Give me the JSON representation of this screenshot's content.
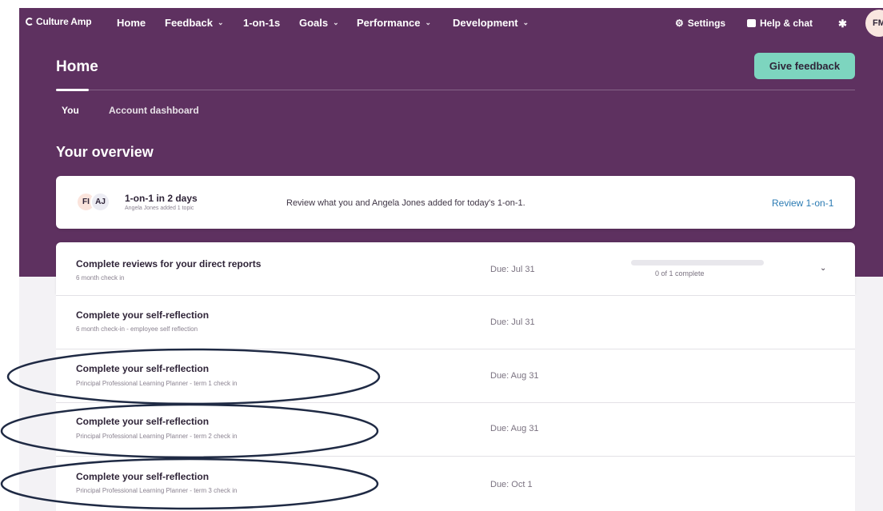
{
  "nav": {
    "logo": "Culture Amp",
    "items": [
      {
        "label": "Home",
        "has_menu": false
      },
      {
        "label": "Feedback",
        "has_menu": true
      },
      {
        "label": "1-on-1s",
        "has_menu": false
      },
      {
        "label": "Goals",
        "has_menu": true
      },
      {
        "label": "Performance",
        "has_menu": true
      },
      {
        "label": "Development",
        "has_menu": true
      }
    ],
    "settings": "Settings",
    "help": "Help & chat",
    "avatar": "FM",
    "chevron_glyph": "⌄"
  },
  "header": {
    "title": "Home",
    "give_feedback": "Give feedback",
    "tabs": [
      {
        "label": "You",
        "active": true
      },
      {
        "label": "Account dashboard",
        "active": false
      }
    ]
  },
  "overview": {
    "title": "Your overview",
    "one_on_one": {
      "avatars": [
        "FI",
        "AJ"
      ],
      "title": "1-on-1 in 2 days",
      "subtitle": "Angela Jones added 1 topic",
      "description": "Review what you and Angela Jones added for today's 1-on-1.",
      "link": "Review 1-on-1"
    }
  },
  "tasks": [
    {
      "title": "Complete reviews for your direct reports",
      "subtitle": "6 month check in",
      "due": "Due: Jul 31",
      "progress": {
        "done": 0,
        "total": 1,
        "label": "0 of 1 complete"
      },
      "expandable": true,
      "circled": false
    },
    {
      "title": "Complete your self-reflection",
      "subtitle": "6 month check-in - employee self reflection",
      "due": "Due: Jul 31",
      "circled": false
    },
    {
      "title": "Complete your self-reflection",
      "subtitle": "Principal Professional Learning Planner - term 1 check in",
      "due": "Due: Aug 31",
      "circled": true
    },
    {
      "title": "Complete your self-reflection",
      "subtitle": "Principal Professional Learning Planner - term 2 check in",
      "due": "Due: Aug 31",
      "circled": true
    },
    {
      "title": "Complete your self-reflection",
      "subtitle": "Principal Professional Learning Planner - term 3 check in",
      "due": "Due: Oct 1",
      "circled": true
    }
  ],
  "colors": {
    "hero": "#5e3160",
    "accent_button": "#7dd5bf",
    "link": "#2b7bb3",
    "annotation": "#1f2a44"
  }
}
